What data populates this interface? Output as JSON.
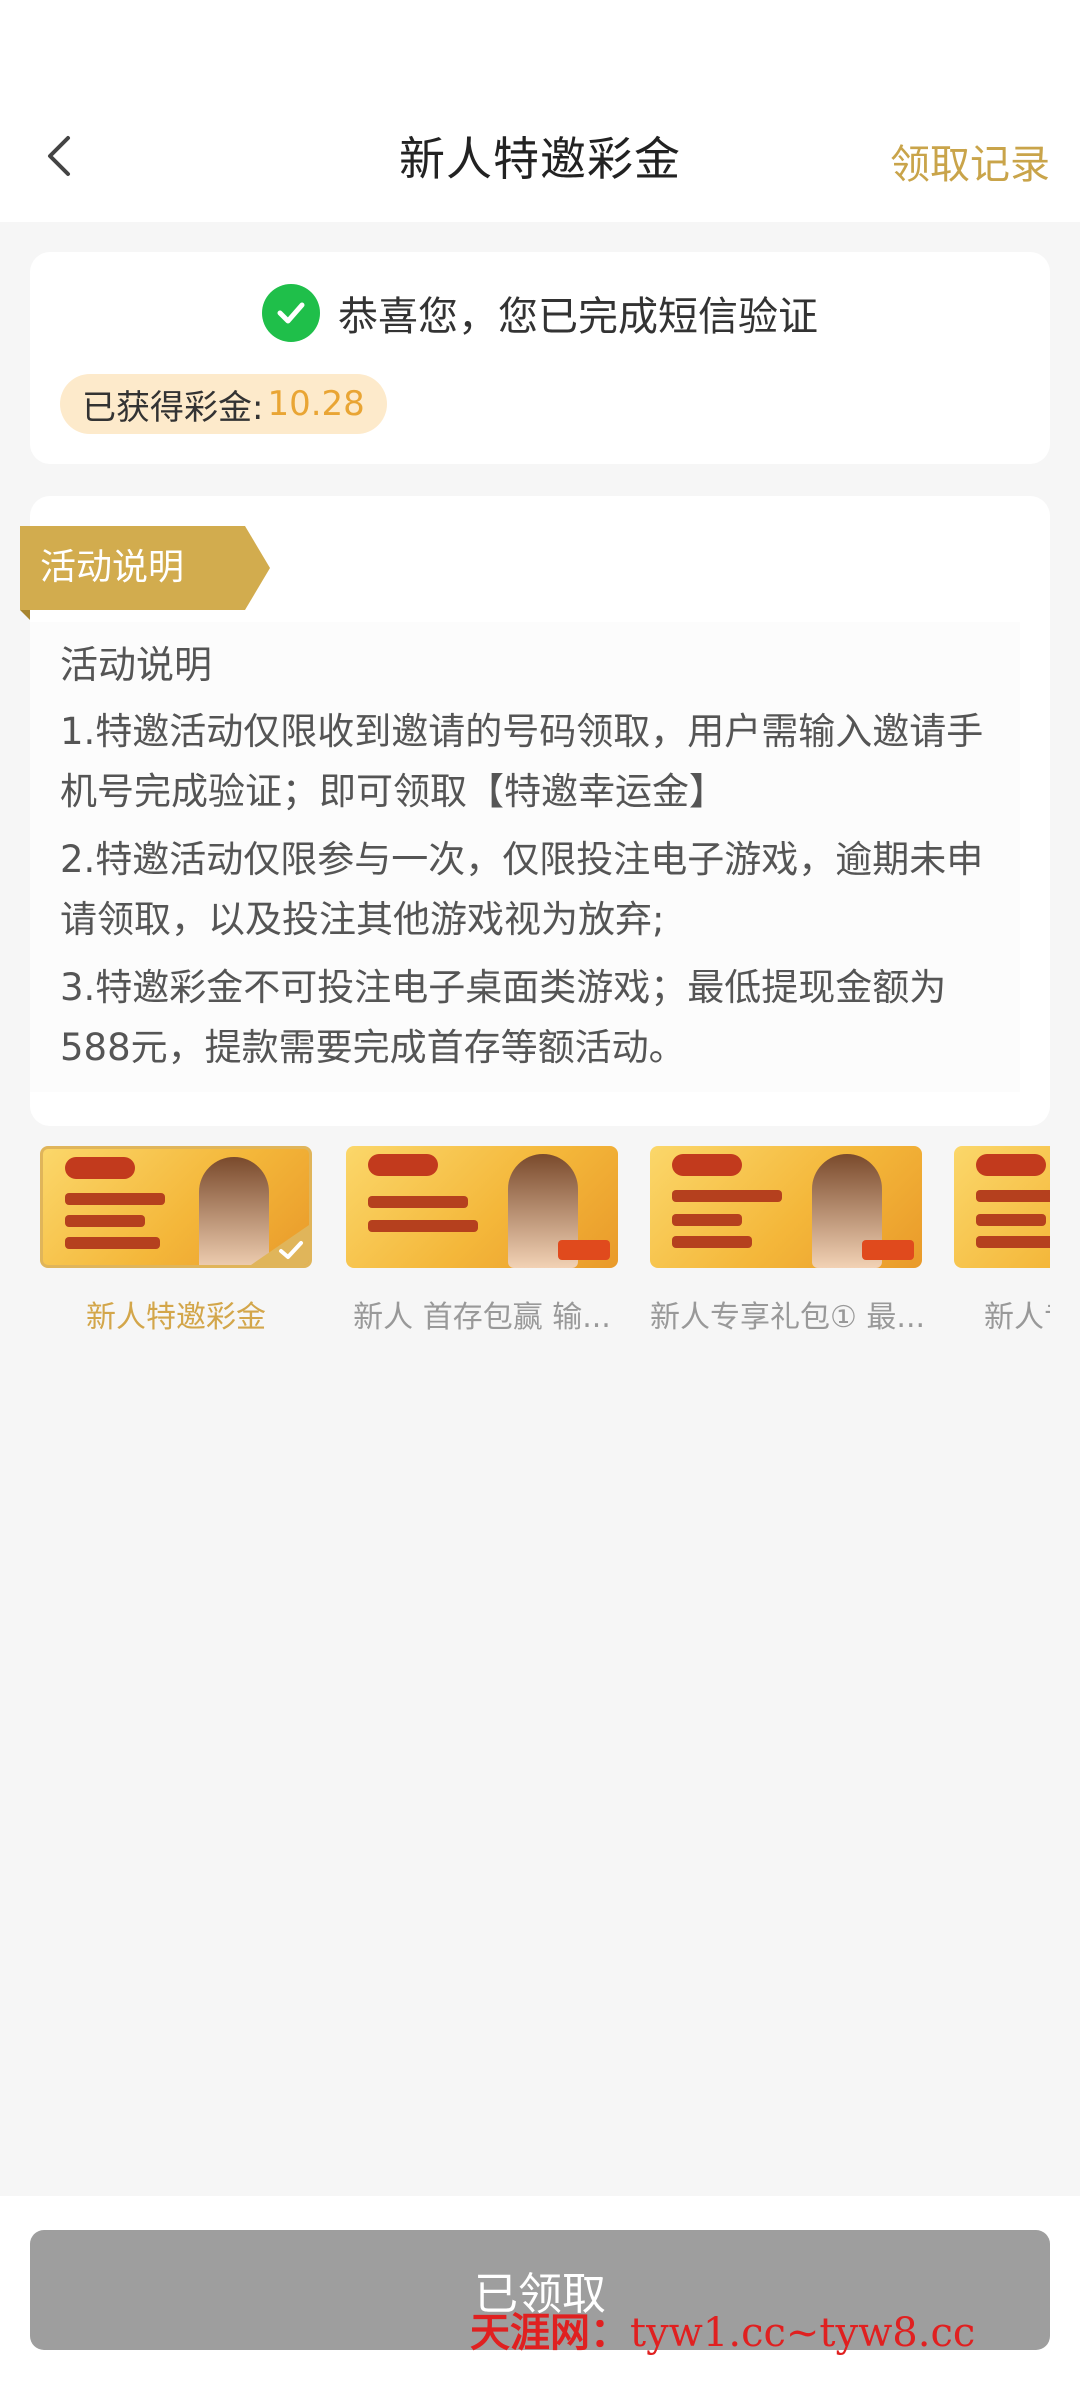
{
  "header": {
    "title": "新人特邀彩金",
    "right_link": "领取记录"
  },
  "verification": {
    "message": "恭喜您，您已完成短信验证",
    "bonus_label": "已获得彩金:",
    "bonus_value": "10.28"
  },
  "activity": {
    "ribbon_label": "活动说明",
    "heading": "活动说明",
    "items": [
      "1.特邀活动仅限收到邀请的号码领取，用户需输入邀请手机号完成验证；即可领取【特邀幸运金】",
      "2.特邀活动仅限参与一次，仅限投注电子游戏，逾期未申请领取，以及投注其他游戏视为放弃;",
      "3.特邀彩金不可投注电子桌面类游戏；最低提现金额为588元，提款需要完成首存等额活动。"
    ]
  },
  "promotions": [
    {
      "label": "新人特邀彩金",
      "active": true
    },
    {
      "label": "新人 首存包赢 输...",
      "active": false
    },
    {
      "label": "新人专享礼包① 最...",
      "active": false
    },
    {
      "label": "新人专",
      "active": false
    }
  ],
  "footer": {
    "button_label": "已领取"
  },
  "watermark": {
    "brand": "天涯网：",
    "domains": "tyw1.cc~tyw8.cc"
  },
  "colors": {
    "accent_gold": "#c9a44a",
    "bonus_orange": "#e9a534",
    "success_green": "#1fbf4a",
    "disabled_gray": "#9e9e9e"
  }
}
